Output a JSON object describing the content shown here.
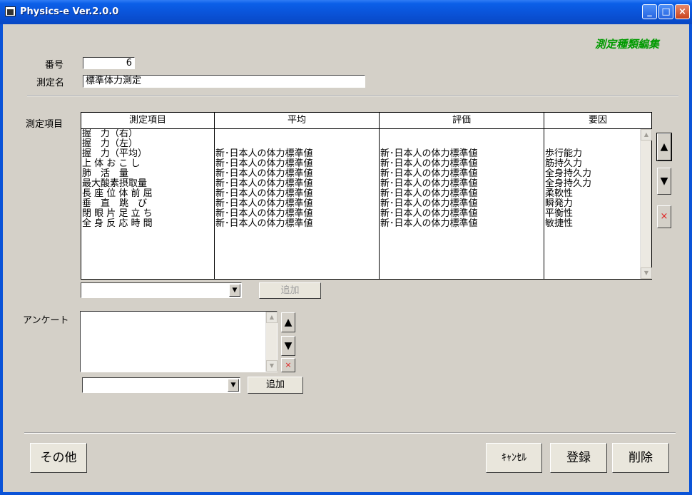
{
  "window": {
    "title": "Physics-e  Ver.2.0.0",
    "minimize": "_",
    "maximize": "□",
    "close": "×"
  },
  "heading": "測定種類編集",
  "form": {
    "number_label": "番号",
    "number_value": "6",
    "name_label": "測定名",
    "name_value": "標準体力測定",
    "items_label": "測定項目",
    "survey_label": "アンケート"
  },
  "grid": {
    "columns": [
      "測定項目",
      "平均",
      "評価",
      "要因"
    ],
    "rows": [
      [
        "握　力（右）",
        "",
        "",
        ""
      ],
      [
        "握　力（左）",
        "",
        "",
        ""
      ],
      [
        "握　力（平均）",
        "新･日本人の体力標準値",
        "新･日本人の体力標準値",
        "歩行能力"
      ],
      [
        "上 体 お こ し",
        "新･日本人の体力標準値",
        "新･日本人の体力標準値",
        "筋持久力"
      ],
      [
        "肺　活　量",
        "新･日本人の体力標準値",
        "新･日本人の体力標準値",
        "全身持久力"
      ],
      [
        "最大酸素摂取量",
        "新･日本人の体力標準値",
        "新･日本人の体力標準値",
        "全身持久力"
      ],
      [
        "長 座 位 体 前 屈",
        "新･日本人の体力標準値",
        "新･日本人の体力標準値",
        "柔軟性"
      ],
      [
        "垂　直　跳　び",
        "新･日本人の体力標準値",
        "新･日本人の体力標準値",
        "瞬発力"
      ],
      [
        "閉 眼 片 足 立 ち",
        "新･日本人の体力標準値",
        "新･日本人の体力標準値",
        "平衡性"
      ],
      [
        "全 身 反 応 時 間",
        "新･日本人の体力標準値",
        "新･日本人の体力標準値",
        "敏捷性"
      ]
    ]
  },
  "buttons": {
    "up": "▲",
    "down": "▼",
    "remove": "×",
    "add": "追加",
    "other": "その他",
    "cancel": "ｷｬﾝｾﾙ",
    "register": "登録",
    "delete": "削除"
  },
  "icons": {
    "dropdown": "▼",
    "scroll_up": "▲",
    "scroll_down": "▼"
  },
  "colors": {
    "heading": "#009a00",
    "remove_icon": "#e02020"
  }
}
